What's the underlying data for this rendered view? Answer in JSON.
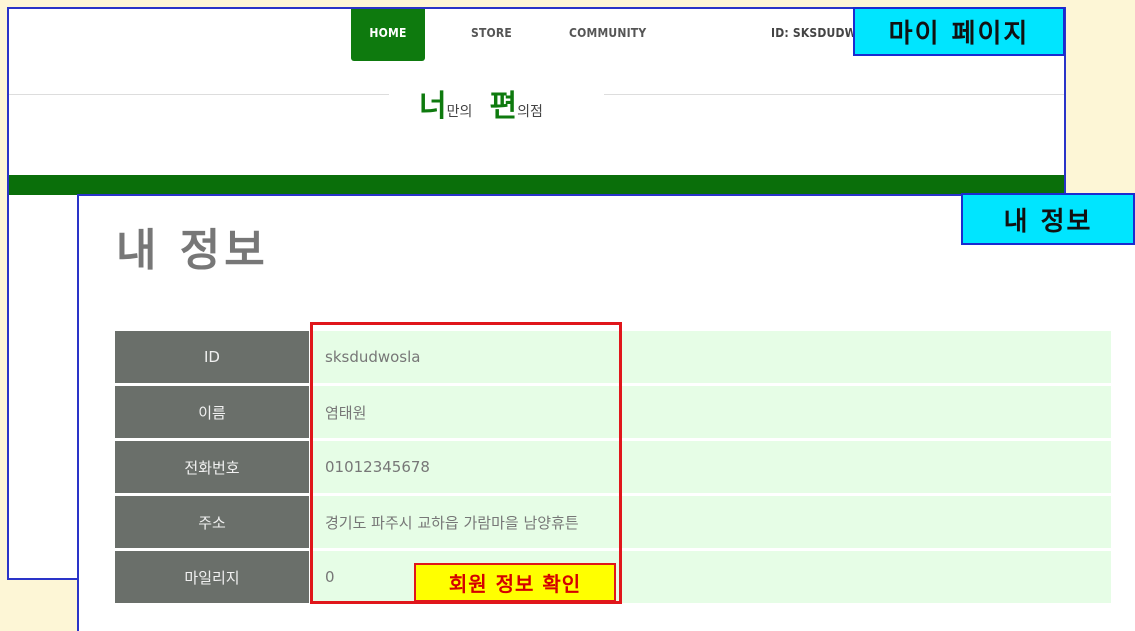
{
  "nav": {
    "home": "HOME",
    "store": "STORE",
    "community": "COMMUNITY",
    "user_id": "ID: SKSDUDWOSLA"
  },
  "logo": {
    "part1_big": "너",
    "part1_small": "만의",
    "part2_big": "편",
    "part2_small": "의점"
  },
  "page": {
    "title": "내 정보"
  },
  "info_rows": [
    {
      "label": "ID",
      "value": "sksdudwosla"
    },
    {
      "label": "이름",
      "value": "염태원"
    },
    {
      "label": "전화번호",
      "value": "01012345678"
    },
    {
      "label": "주소",
      "value": "경기도 파주시 교하읍 가람마을 남양휴튼"
    },
    {
      "label": "마일리지",
      "value": "0"
    }
  ],
  "callouts": {
    "my_page": "마이 페이지",
    "my_info": "내 정보",
    "verify": "회원 정보 확인"
  },
  "colors": {
    "brand_green": "#0e7a0e",
    "label_bg": "#6a6f6a",
    "value_bg": "#e6fde6",
    "callout_cyan": "#00e5ff",
    "callout_yellow": "#ffff00",
    "highlight_red": "#e0161b"
  }
}
